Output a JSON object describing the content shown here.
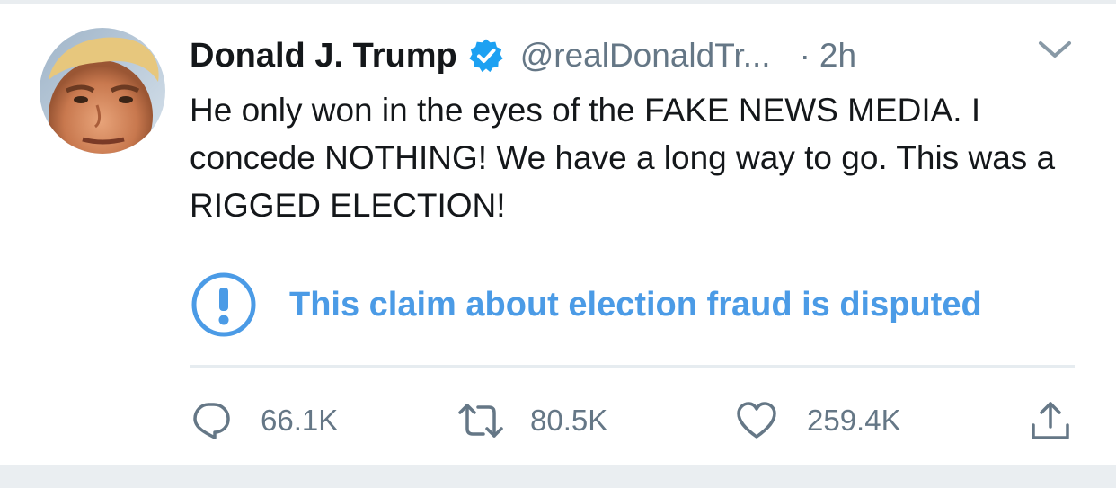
{
  "tweet": {
    "display_name": "Donald J. Trump",
    "verified_icon": "verified-badge-icon",
    "handle": "@realDonaldTr...",
    "dot": "·",
    "time": "2h",
    "text": "He only won in the eyes of the FAKE NEWS MEDIA. I concede NOTHING! We have a long way to go. This was a RIGGED ELECTION!",
    "label": {
      "icon": "exclamation-circle-icon",
      "text": "This claim about election fraud is disputed"
    },
    "actions": {
      "reply_count": "66.1K",
      "retweet_count": "80.5K",
      "like_count": "259.4K"
    }
  },
  "colors": {
    "text": "#14171a",
    "muted": "#657786",
    "accent_blue": "#1da1f2",
    "label_blue": "#4b9be6",
    "divider": "#e6ecf0"
  }
}
